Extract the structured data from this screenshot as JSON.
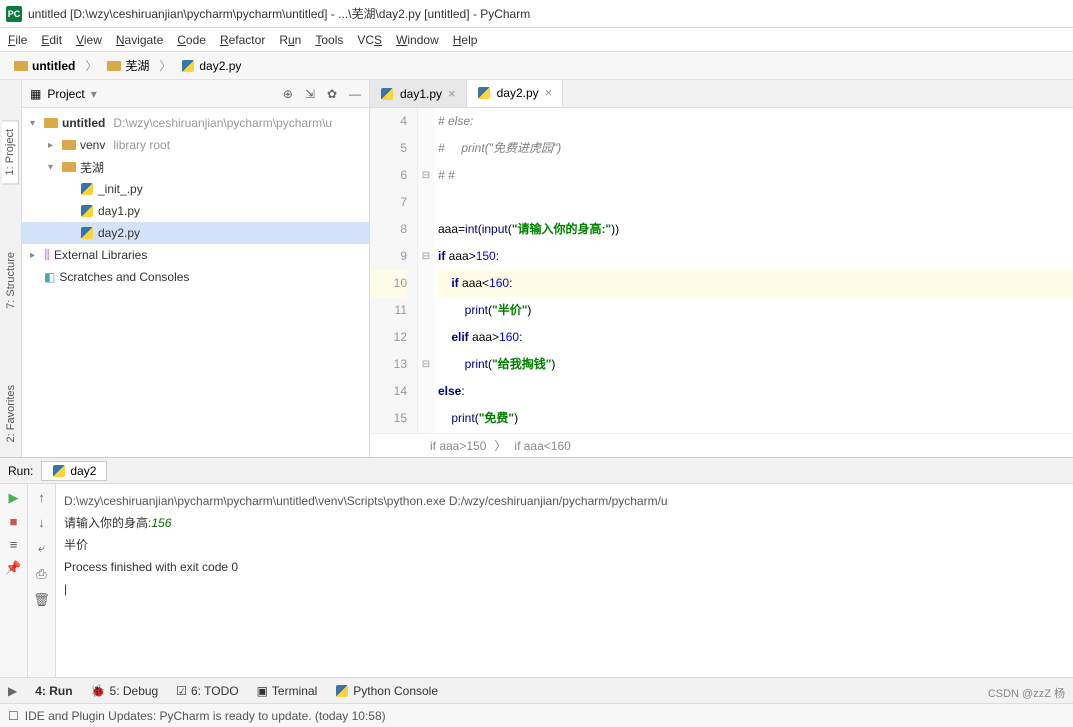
{
  "window": {
    "title": "untitled [D:\\wzy\\ceshiruanjian\\pycharm\\pycharm\\untitled] - ...\\芜湖\\day2.py [untitled] - PyCharm"
  },
  "menu": {
    "file": "File",
    "edit": "Edit",
    "view": "View",
    "navigate": "Navigate",
    "code": "Code",
    "refactor": "Refactor",
    "run": "Run",
    "tools": "Tools",
    "vcs": "VCS",
    "window": "Window",
    "help": "Help"
  },
  "navbar": {
    "root": "untitled",
    "folder": "芜湖",
    "file": "day2.py"
  },
  "project": {
    "title": "Project",
    "root": "untitled",
    "root_path": "D:\\wzy\\ceshiruanjian\\pycharm\\pycharm\\u",
    "venv": "venv",
    "venv_suffix": "library root",
    "folder": "芜湖",
    "files": [
      "_init_.py",
      "day1.py",
      "day2.py"
    ],
    "ext_lib": "External Libraries",
    "scratches": "Scratches and Consoles"
  },
  "tabs": {
    "tab1": "day1.py",
    "tab2": "day2.py"
  },
  "code": {
    "l4": "# else:",
    "l5": "#     print(\"免费进虎园\")",
    "l6": "# #",
    "l7": "",
    "l8_a": "aaa=",
    "l8_fn": "int",
    "l8_p1": "(",
    "l8_inp": "input",
    "l8_p2": "(",
    "l8_s": "\"请输入你的身高:\"",
    "l8_p3": "))",
    "l9_if": "if ",
    "l9_v": "aaa>",
    "l9_n": "150",
    "l9_c": ":",
    "l10_if": "if ",
    "l10_v": "aaa<",
    "l10_n": "160",
    "l10_c": ":",
    "l11_fn": "print",
    "l11_p": "(",
    "l11_s": "\"半价\"",
    "l11_e": ")",
    "l12_elif": "elif ",
    "l12_v": "aaa>",
    "l12_n": "160",
    "l12_c": ":",
    "l13_fn": "print",
    "l13_p": "(",
    "l13_s": "\"给我掏钱\"",
    "l13_e": ")",
    "l14_else": "else",
    "l14_c": ":",
    "l15_fn": "print",
    "l15_p": "(",
    "l15_s": "\"免费\"",
    "l15_e": ")"
  },
  "breadcrumb": {
    "b1": "if aaa>150",
    "b2": "if aaa<160"
  },
  "run": {
    "label": "Run:",
    "tab": "day2",
    "path": "D:\\wzy\\ceshiruanjian\\pycharm\\pycharm\\untitled\\venv\\Scripts\\python.exe D:/wzy/ceshiruanjian/pycharm/pycharm/u",
    "prompt": "请输入你的身高:",
    "input": "156",
    "output": "半价",
    "exit": "Process finished with exit code 0"
  },
  "bottom": {
    "run": "4: Run",
    "debug": "5: Debug",
    "todo": "6: TODO",
    "terminal": "Terminal",
    "python_console": "Python Console"
  },
  "sidetabs": {
    "project": "1: Project",
    "structure": "7: Structure",
    "favorites": "2: Favorites"
  },
  "status": {
    "msg": "IDE and Plugin Updates: PyCharm is ready to update. (today 10:58)"
  },
  "watermark": "CSDN @zzZ 杨"
}
